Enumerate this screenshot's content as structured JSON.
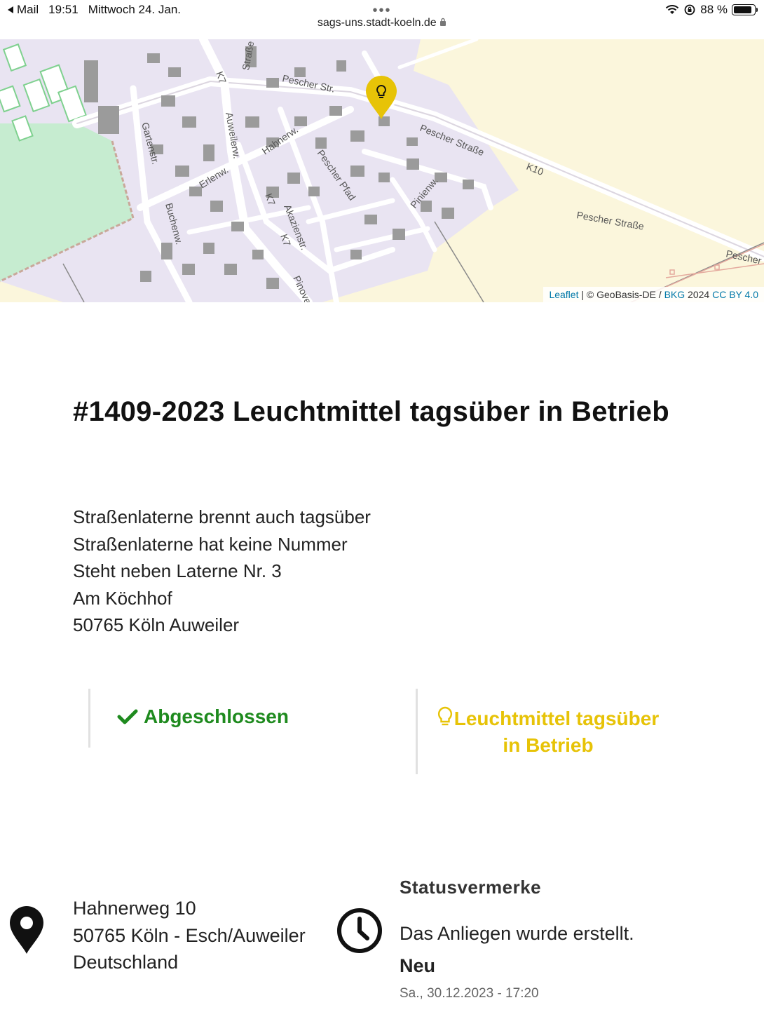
{
  "statusbar": {
    "back_label": "Mail",
    "time": "19:51",
    "date": "Mittwoch 24. Jan.",
    "url": "sags-uns.stadt-koeln.de",
    "battery": "88 %",
    "battery_level": 0.88
  },
  "map": {
    "street_labels": {
      "strasse_top": "Straße",
      "k7_top": "K7",
      "pescher_str": "Pescher Str.",
      "gartenstr": "Gartenstr.",
      "auweilerw": "Auweilerw.",
      "hahnerw": "Hahnerw.",
      "pescher_strasse_1": "Pescher Straße",
      "k10": "K10",
      "pescher_pfad": "Pescher Pfad",
      "erlenw": "Erlenw.",
      "k7_mid": "K7",
      "pinienw": "Pinienw.",
      "buchenw": "Buchenw.",
      "akazienstr": "Akazienstr.",
      "k7_low": "K7",
      "pescher_strasse_2": "Pescher Straße",
      "pescher_edge": "Pescher",
      "pinov": "Pinove"
    },
    "attribution": {
      "leaflet": "Leaflet",
      "sep1": " | © GeoBasis-DE / ",
      "bkg": "BKG",
      "year": " 2024 ",
      "license": "CC BY 4.0"
    },
    "marker_color": "#e7c307"
  },
  "report": {
    "title": "#1409-2023 Leuchtmittel tagsüber in Betrieb",
    "description": [
      "Straßenlaterne brennt auch tagsüber",
      "Straßenlaterne hat keine Nummer",
      "Steht neben Laterne Nr. 3",
      "Am Köchhof",
      "50765 Köln Auweiler"
    ],
    "status": "Abgeschlossen",
    "status_color": "#1e8a1e",
    "category": "Leuchtmittel tagsüber in Betrieb",
    "category_color": "#e7c307",
    "address": [
      "Hahnerweg 10",
      "50765 Köln - Esch/Auweiler",
      "Deutschland"
    ],
    "status_notes": {
      "heading": "Statusvermerke",
      "text": "Das Anliegen wurde erstellt.",
      "status": "Neu",
      "date": "Sa., 30.12.2023 - 17:20"
    }
  }
}
